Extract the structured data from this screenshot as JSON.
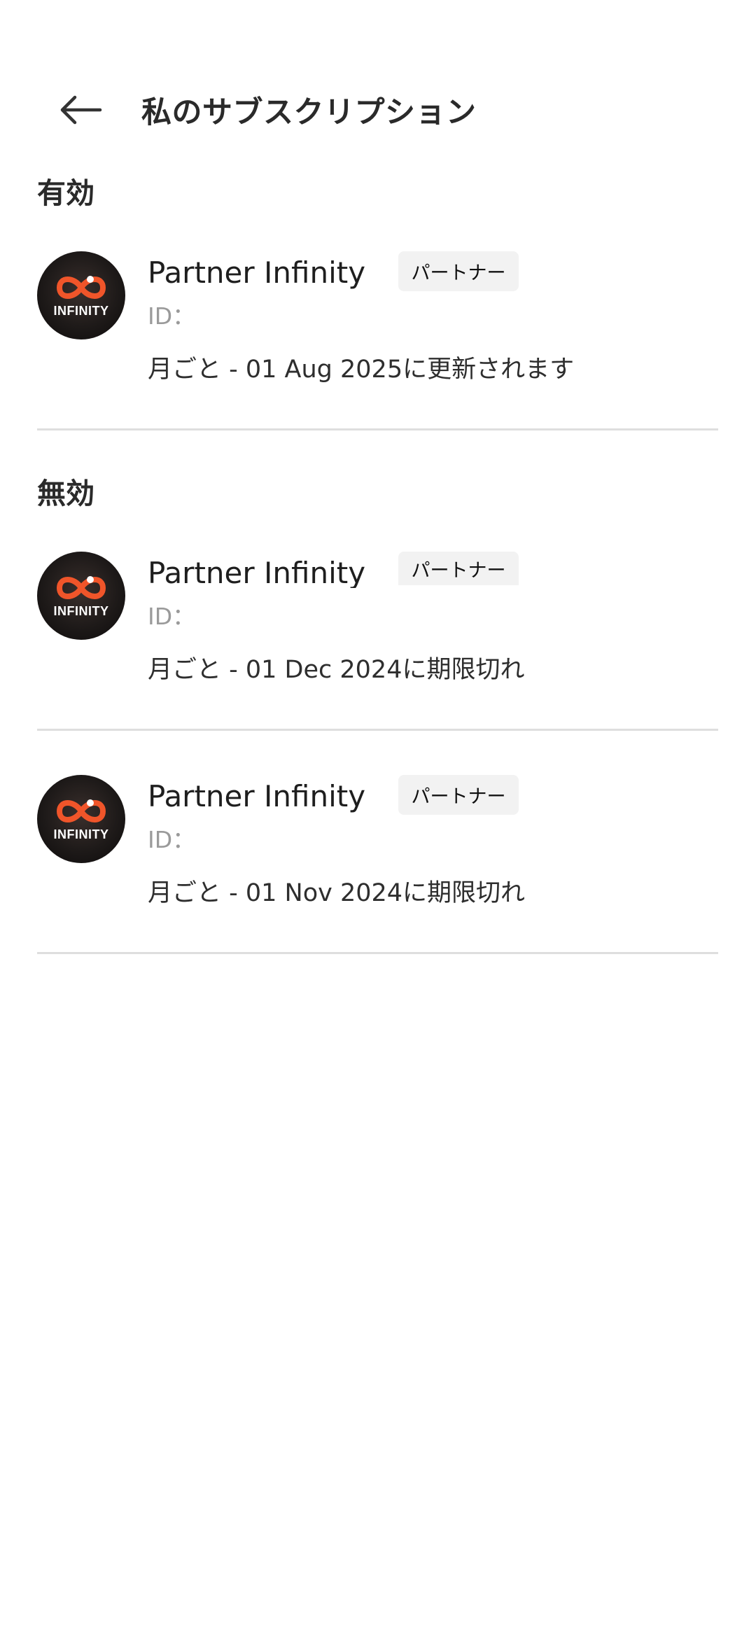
{
  "header": {
    "title": "私のサブスクリプション",
    "back_icon": "arrow-left-icon"
  },
  "sections": {
    "active": {
      "title": "有効",
      "items": [
        {
          "name": "Partner Infinity",
          "badge": "パートナー",
          "id_label": "ID：",
          "status": "月ごと - 01 Aug 2025に更新されます",
          "avatar_text": "INFINITY"
        }
      ]
    },
    "inactive": {
      "title": "無効",
      "items": [
        {
          "name": "Partner Infinity",
          "badge": "パートナー",
          "id_label": "ID：",
          "status": "月ごと - 01 Dec 2024に期限切れ",
          "avatar_text": "INFINITY"
        },
        {
          "name": "Partner Infinity",
          "badge": "パートナー",
          "id_label": "ID：",
          "status": "月ごと - 01 Nov 2024に期限切れ",
          "avatar_text": "INFINITY"
        }
      ]
    }
  },
  "colors": {
    "logo_accent": "#f0552a",
    "divider": "#dedede",
    "badge_bg": "#f2f2f2",
    "muted_text": "#9a9a9a"
  }
}
